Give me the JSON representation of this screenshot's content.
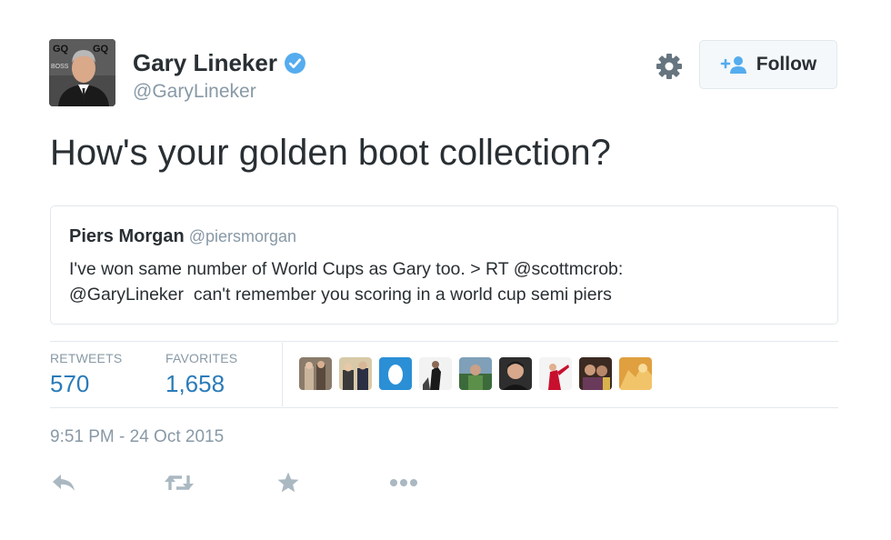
{
  "author": {
    "name": "Gary Lineker",
    "handle": "@GaryLineker",
    "verified": true,
    "avatar_backdrop_text": [
      "BOSS",
      "GQ"
    ]
  },
  "follow_button": {
    "label": "Follow"
  },
  "tweet": {
    "text": "How's your golden boot collection?"
  },
  "quoted_tweet": {
    "author_name": "Piers Morgan",
    "author_handle": "@piersmorgan",
    "lines": [
      "I've won same number of World Cups as Gary too. > RT @scottmcrob:",
      "@GaryLineker  can't remember you scoring in a world cup semi piers"
    ]
  },
  "stats": {
    "retweets_label": "RETWEETS",
    "retweets_count": "570",
    "favorites_label": "FAVORITES",
    "favorites_count": "1,658"
  },
  "favoriters": [
    {
      "name": "favoriter-avatar-1"
    },
    {
      "name": "favoriter-avatar-2"
    },
    {
      "name": "favoriter-avatar-3-default-egg"
    },
    {
      "name": "favoriter-avatar-4"
    },
    {
      "name": "favoriter-avatar-5"
    },
    {
      "name": "favoriter-avatar-6"
    },
    {
      "name": "favoriter-avatar-7"
    },
    {
      "name": "favoriter-avatar-8"
    },
    {
      "name": "favoriter-avatar-9"
    }
  ],
  "timestamp": "9:51 PM - 24 Oct 2015",
  "actions": [
    "reply-icon",
    "retweet-icon",
    "favorite-star-icon",
    "more-options-icon"
  ],
  "colors": {
    "text": "#292f33",
    "secondary": "#8899a6",
    "link": "#2b7bb9",
    "verified": "#55acee",
    "border": "#e1e8ed",
    "action_icon": "#aab8c2"
  }
}
